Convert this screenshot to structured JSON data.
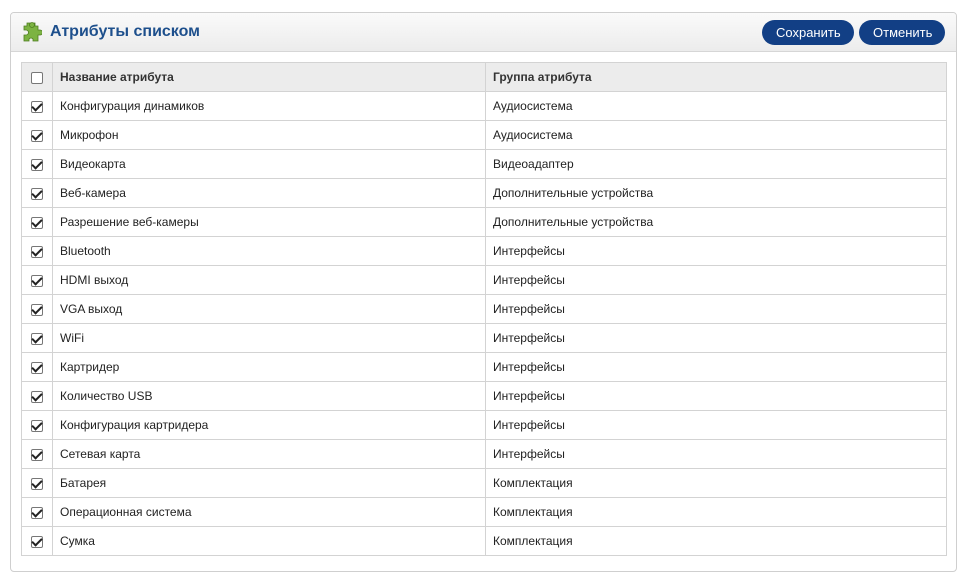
{
  "header": {
    "title": "Атрибуты списком",
    "save_label": "Сохранить",
    "cancel_label": "Отменить"
  },
  "table": {
    "columns": [
      "Название атрибута",
      "Группа атрибута"
    ],
    "select_all_checked": false,
    "rows": [
      {
        "name": "Конфигурация динамиков",
        "group": "Аудиосистема",
        "checked": true
      },
      {
        "name": "Микрофон",
        "group": "Аудиосистема",
        "checked": true
      },
      {
        "name": "Видеокарта",
        "group": "Видеоадаптер",
        "checked": true
      },
      {
        "name": "Веб-камера",
        "group": "Дополнительные устройства",
        "checked": true
      },
      {
        "name": "Разрешение веб-камеры",
        "group": "Дополнительные устройства",
        "checked": true
      },
      {
        "name": "Bluetooth",
        "group": "Интерфейсы",
        "checked": true
      },
      {
        "name": "HDMI выход",
        "group": "Интерфейсы",
        "checked": true
      },
      {
        "name": "VGA выход",
        "group": "Интерфейсы",
        "checked": true
      },
      {
        "name": "WiFi",
        "group": "Интерфейсы",
        "checked": true
      },
      {
        "name": "Картридер",
        "group": "Интерфейсы",
        "checked": true
      },
      {
        "name": "Количество USB",
        "group": "Интерфейсы",
        "checked": true
      },
      {
        "name": "Конфигурация картридера",
        "group": "Интерфейсы",
        "checked": true
      },
      {
        "name": "Сетевая карта",
        "group": "Интерфейсы",
        "checked": true
      },
      {
        "name": "Батарея",
        "group": "Комплектация",
        "checked": true
      },
      {
        "name": "Операционная система",
        "group": "Комплектация",
        "checked": true
      },
      {
        "name": "Сумка",
        "group": "Комплектация",
        "checked": true
      }
    ]
  },
  "colors": {
    "button_bg": "#123f85",
    "title": "#1d4f8c",
    "icon": "#7cb342"
  }
}
